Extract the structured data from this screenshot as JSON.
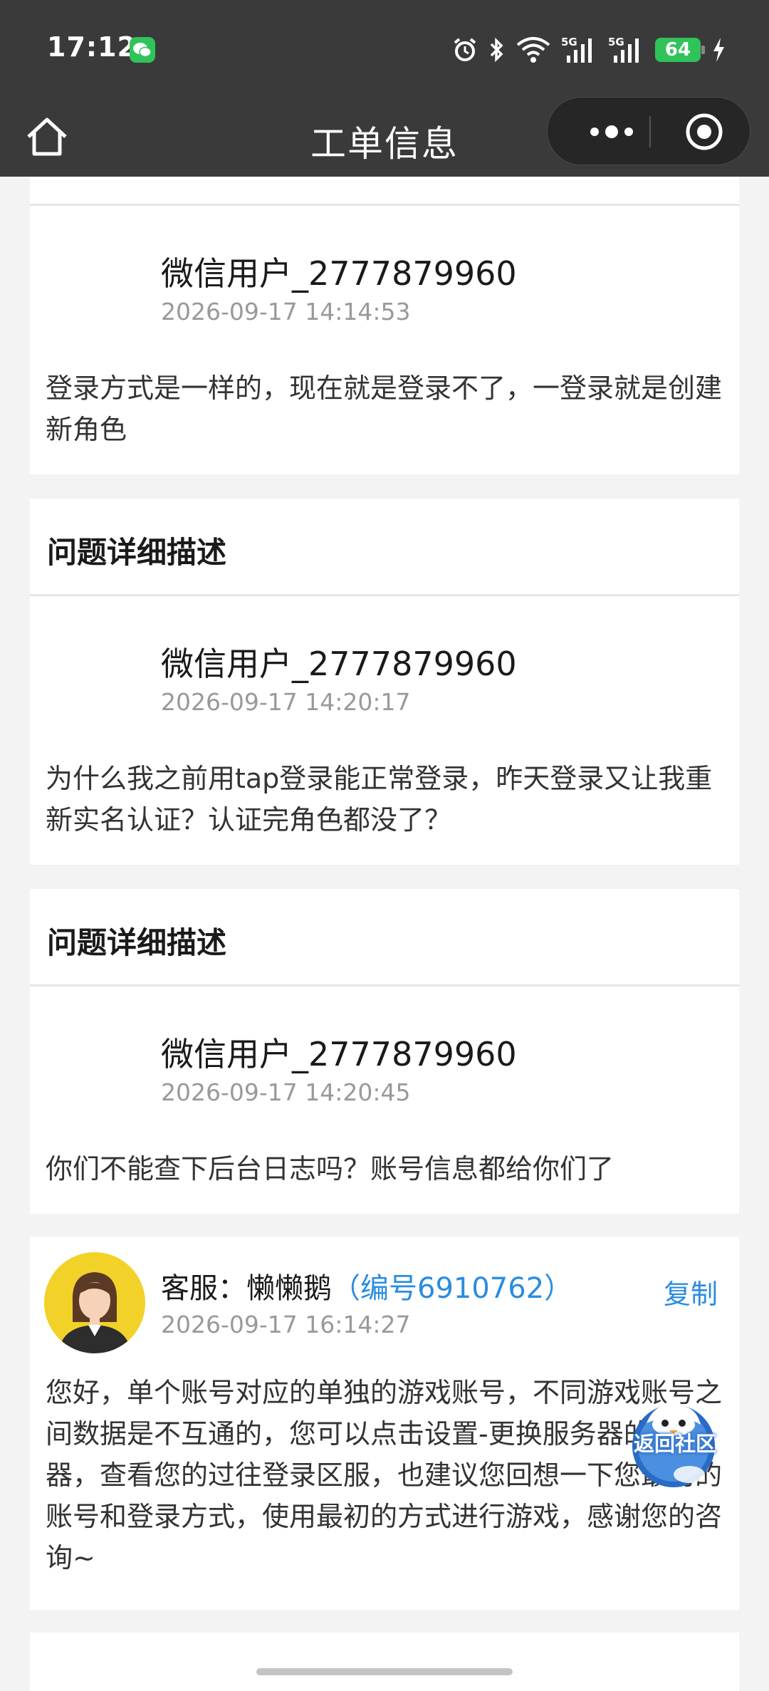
{
  "status_bar": {
    "time": "17:12",
    "battery": "64",
    "network": "5G"
  },
  "nav": {
    "title": "工单信息"
  },
  "entries": [
    {
      "username": "微信用户_2777879960",
      "time": "2026-09-17 14:14:53",
      "message": "登录方式是一样的，现在就是登录不了，一登录就是创建新角色"
    },
    {
      "section_title": "问题详细描述",
      "username": "微信用户_2777879960",
      "time": "2026-09-17 14:20:17",
      "message": "为什么我之前用tap登录能正常登录，昨天登录又让我重新实名认证？认证完角色都没了？"
    },
    {
      "section_title": "问题详细描述",
      "username": "微信用户_2777879960",
      "time": "2026-09-17 14:20:45",
      "message": "你们不能查下后台日志吗？账号信息都给你们了"
    }
  ],
  "agent_reply": {
    "label": "客服：懒懒鹅",
    "agent_id": "（编号6910762）",
    "copy_label": "复制",
    "time": "2026-09-17 16:14:27",
    "message": "您好，单个账号对应的单独的游戏账号，不同游戏账号之间数据是不互通的，您可以点击设置-更换服务器的服务器，查看您的过往登录区服，也建议您回想一下您最初的账号和登录方式，使用最初的方式进行游戏，感谢您的咨询~"
  },
  "float_button": {
    "label": "返回社区"
  },
  "colors": {
    "accent": "#2a8ce0",
    "bar": "#3a3a3a",
    "background": "#f3f3f3"
  }
}
